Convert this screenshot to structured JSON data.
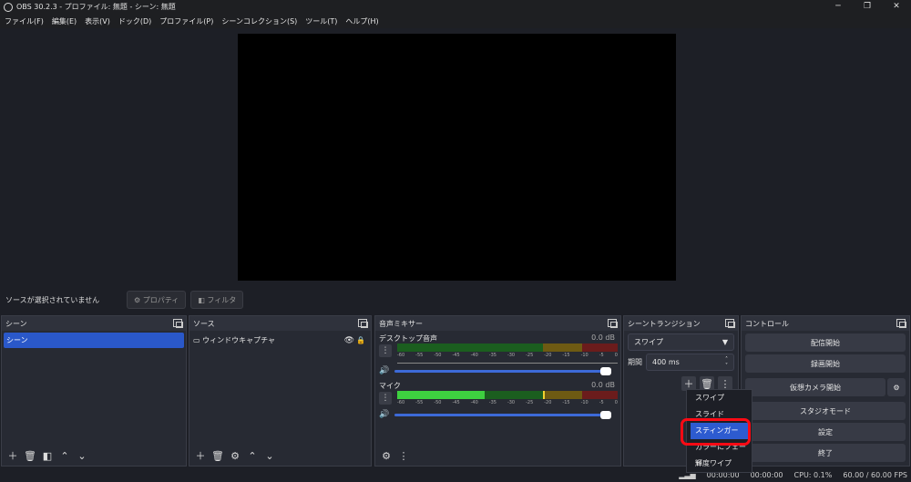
{
  "window": {
    "title": "OBS 30.2.3 - プロファイル: 無題 - シーン: 無題",
    "min": "─",
    "max": "❐",
    "close": "✕"
  },
  "menu": [
    "ファイル(F)",
    "編集(E)",
    "表示(V)",
    "ドック(D)",
    "プロファイル(P)",
    "シーンコレクション(S)",
    "ツール(T)",
    "ヘルプ(H)"
  ],
  "source_bar": {
    "no_selection": "ソースが選択されていません",
    "properties": "プロパティ",
    "filters": "フィルタ"
  },
  "scenes": {
    "title": "シーン",
    "items": [
      "シーン"
    ]
  },
  "sources": {
    "title": "ソース",
    "items": [
      "ウィンドウキャプチャ"
    ]
  },
  "mixer": {
    "title": "音声ミキサー",
    "ticks": [
      "-60",
      "-55",
      "-50",
      "-45",
      "-40",
      "-35",
      "-30",
      "-25",
      "-20",
      "-15",
      "-10",
      "-5",
      "0"
    ],
    "channels": [
      {
        "name": "デスクトップ音声",
        "db": "0.0 dB"
      },
      {
        "name": "マイク",
        "db": "0.0 dB"
      }
    ]
  },
  "transitions": {
    "title": "シーントランジション",
    "selected": "スワイプ",
    "duration_label": "期間",
    "duration_value": "400 ms"
  },
  "controls": {
    "title": "コントロール",
    "buttons": [
      "配信開始",
      "録画開始",
      "仮想カメラ開始",
      "スタジオモード",
      "設定",
      "終了"
    ]
  },
  "dropdown": {
    "items": [
      "スワイプ",
      "スライド",
      "スティンガー",
      "カラーにフェード",
      "輝度ワイプ"
    ],
    "selected_index": 2
  },
  "status": {
    "stream_time": "00:00:00",
    "rec_time": "00:00:00",
    "cpu": "CPU: 0.1%",
    "fps": "60.00 / 60.00 FPS"
  }
}
